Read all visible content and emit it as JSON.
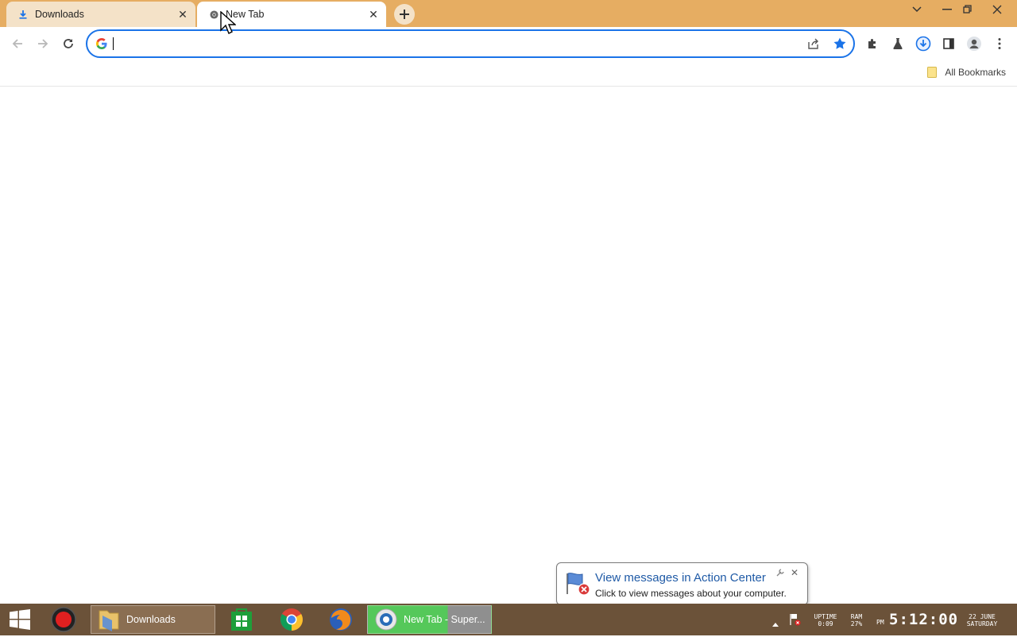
{
  "browser": {
    "tabs": [
      {
        "title": "Downloads",
        "favicon": "download-icon",
        "active": false
      },
      {
        "title": "New Tab",
        "favicon": "chrome-icon",
        "active": true
      }
    ],
    "omnibox": {
      "value": "",
      "placeholder": ""
    },
    "bookmarks_bar": {
      "all_bookmarks_label": "All Bookmarks"
    },
    "accent_color": "#1a73e8",
    "frame_color": "#e6ad62"
  },
  "notification": {
    "title": "View messages in Action Center",
    "text": "Click to view messages about your computer."
  },
  "taskbar": {
    "apps": [
      {
        "name": "start-icon"
      },
      {
        "name": "record-icon"
      },
      {
        "name": "file-explorer",
        "label": "Downloads"
      },
      {
        "name": "store-icon"
      },
      {
        "name": "chrome-icon"
      },
      {
        "name": "firefox-icon"
      },
      {
        "name": "browser-window",
        "label": "New Tab - Super..."
      }
    ],
    "tray": {
      "uptime_label": "UPTIME",
      "uptime_value": "0:09",
      "ram_label": "RAM",
      "ram_value": "27%",
      "ampm": "PM",
      "time": "5:12:00",
      "date": "22 JUNE",
      "day": "SATURDAY"
    },
    "color": "#6b5239"
  }
}
